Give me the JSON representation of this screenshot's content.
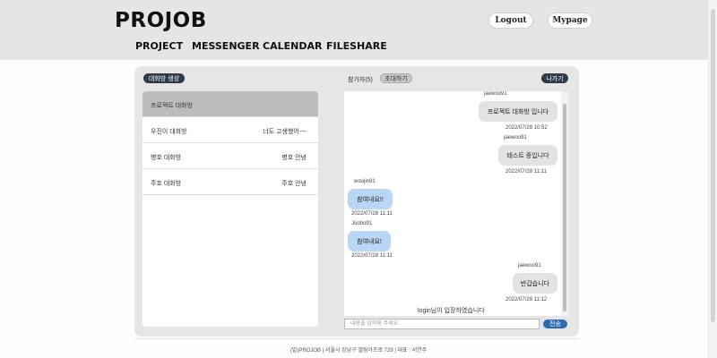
{
  "header": {
    "logo": "PROJOB",
    "logout_label": "Logout",
    "mypage_label": "Mypage",
    "nav": [
      "PROJECT",
      "MESSENGER",
      "CALENDAR",
      "FILESHARE"
    ]
  },
  "toolbar": {
    "create_room_label": "대화방 생성",
    "participants_label": "참가자(5)",
    "invite_label": "초대하기",
    "leave_label": "나가기"
  },
  "rooms": [
    {
      "name": "프로젝트 대화방",
      "last": "",
      "active": true
    },
    {
      "name": "우진이 대화방",
      "last": "너도 고생했어~~"
    },
    {
      "name": "병호 대화방",
      "last": "병호 안녕"
    },
    {
      "name": "주호 대화방",
      "last": "주호 안녕"
    }
  ],
  "messages": [
    {
      "user": "jaewoo91",
      "text": "프로젝트 대화방 입니다",
      "time": "2022/07/28 10:52",
      "side": "me"
    },
    {
      "user": "jaewoo91",
      "text": "테스트 중입니다",
      "time": "2022/07/28 11:11",
      "side": "me"
    },
    {
      "user": "woojin91",
      "text": "참여내요!!",
      "time": "2022/07/28 11:11",
      "side": "other"
    },
    {
      "user": "Jooho91",
      "text": "참여내요!",
      "time": "2022/07/28 11:11",
      "side": "other"
    },
    {
      "user": "jaewoo91",
      "text": "반갑습니다",
      "time": "2022/07/28 11:12",
      "side": "me"
    }
  ],
  "system_message": "login님이 입장하였습니다",
  "input": {
    "placeholder": "내용을 입력해 주세요",
    "value": ""
  },
  "send_label": "전송",
  "footer": "(밑)PROJOB | 서울시 강남구 엘림아조로 729 | 대표 : 서연주",
  "colors": {
    "accent": "#2d6bb5",
    "dark_pill": "#2f3a4a",
    "other_bubble": "#b9d6f5"
  }
}
